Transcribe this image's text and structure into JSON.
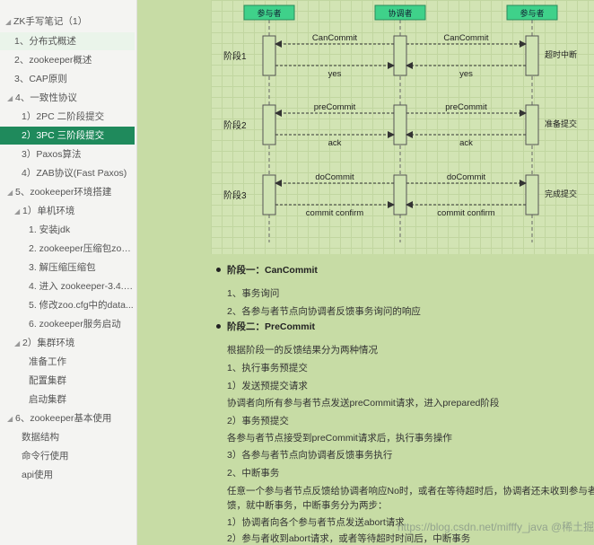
{
  "sidebar": {
    "title": "ZK手写笔记（1）",
    "items": [
      {
        "label": "1、分布式概述",
        "indent": 1,
        "state": "hover"
      },
      {
        "label": "2、zookeeper概述",
        "indent": 1
      },
      {
        "label": "3、CAP原则",
        "indent": 1
      },
      {
        "label": "4、一致性协议",
        "indent": 0,
        "arrow": "◢"
      },
      {
        "label": "1）2PC 二阶段提交",
        "indent": 2
      },
      {
        "label": "2）3PC 三阶段提交",
        "indent": 2,
        "state": "active"
      },
      {
        "label": "3）Paxos算法",
        "indent": 2
      },
      {
        "label": "4）ZAB协议(Fast Paxos)",
        "indent": 2
      },
      {
        "label": "5、zookeeper环境搭建",
        "indent": 0,
        "arrow": "◢"
      },
      {
        "label": "1）单机环境",
        "indent": 1,
        "arrow": "◢"
      },
      {
        "label": "1. 安装jdk",
        "indent": 3
      },
      {
        "label": "2. zookeeper压缩包zook...",
        "indent": 3
      },
      {
        "label": "3. 解压缩压缩包",
        "indent": 3
      },
      {
        "label": "4. 进入 zookeeper-3.4.1...",
        "indent": 3
      },
      {
        "label": "5. 修改zoo.cfg中的data...",
        "indent": 3
      },
      {
        "label": "6. zookeeper服务启动",
        "indent": 3
      },
      {
        "label": "2）集群环境",
        "indent": 1,
        "arrow": "◢"
      },
      {
        "label": "准备工作",
        "indent": 3
      },
      {
        "label": "配置集群",
        "indent": 3
      },
      {
        "label": "启动集群",
        "indent": 3
      },
      {
        "label": "6、zookeeper基本使用",
        "indent": 0,
        "arrow": "◢"
      },
      {
        "label": "数据结构",
        "indent": 2
      },
      {
        "label": "命令行使用",
        "indent": 2
      },
      {
        "label": "api使用",
        "indent": 2
      }
    ]
  },
  "diagram": {
    "participants": [
      "参与者",
      "协调者",
      "参与者"
    ],
    "phases": [
      {
        "label": "阶段1",
        "request": "CanCommit",
        "response": "yes",
        "note": "超时中断"
      },
      {
        "label": "阶段2",
        "request": "preCommit",
        "response": "ack",
        "note": "准备提交"
      },
      {
        "label": "阶段3",
        "request": "doCommit",
        "response": "commit confirm",
        "note": "完成提交"
      }
    ]
  },
  "content": {
    "phase1_title": "阶段一：CanCommit",
    "phase1_line1": "1、事务询问",
    "phase1_line2": "2、各参与者节点向协调者反馈事务询问的响应",
    "phase2_title": "阶段二：PreCommit",
    "p2_l1": "根据阶段一的反馈结果分为两种情况",
    "p2_l2": "1、执行事务预提交",
    "p2_l3": "1）发送预提交请求",
    "p2_l4": "协调者向所有参与者节点发送preCommit请求，进入prepared阶段",
    "p2_l5": "2）事务预提交",
    "p2_l6": "各参与者节点接受到preCommit请求后，执行事务操作",
    "p2_l7": "3）各参与者节点向协调者反馈事务执行",
    "p2_l8": "2、中断事务",
    "p2_l9": "任意一个参与者节点反馈给协调者响应No时，或者在等待超时后，协调者还未收到参与者的反",
    "p2_l10": "馈，就中断事务，中断事务分为两步：",
    "p2_l11": "1）协调者向各个参与者节点发送abort请求",
    "p2_l12": "2）参与者收到abort请求，或者等待超时时间后，中断事务"
  },
  "watermark": "https://blog.csdn.net/mifffy_java   @稀土掘金技术社区"
}
